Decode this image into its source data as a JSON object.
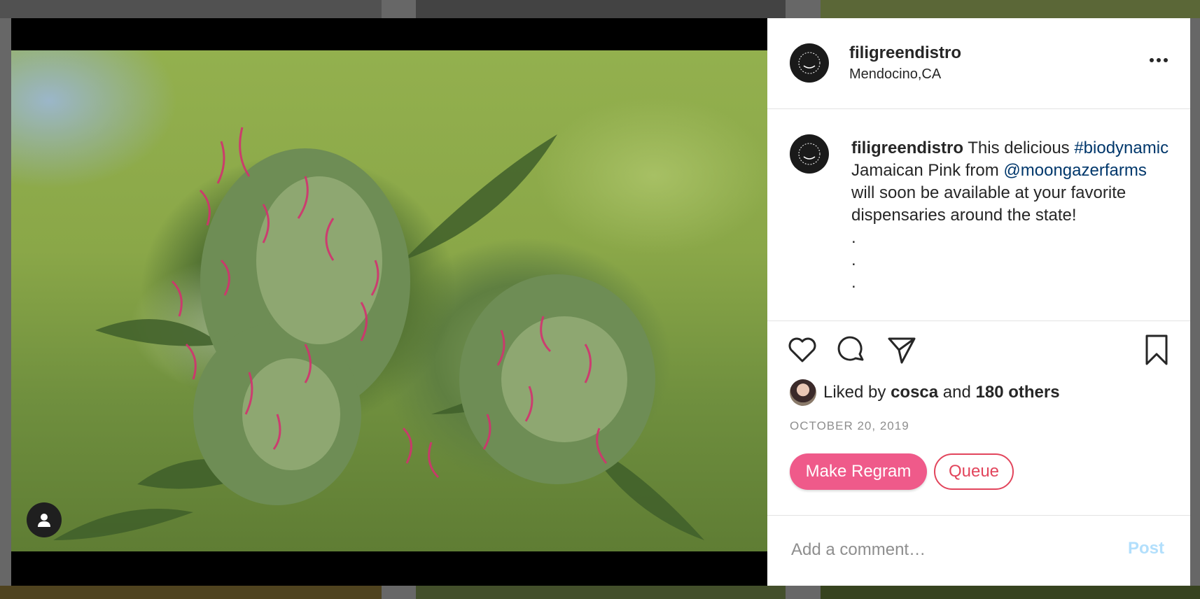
{
  "post": {
    "username": "filigreendistro",
    "location": "Mendocino,CA",
    "caption": {
      "username": "filigreendistro",
      "text_1": " This delicious ",
      "hashtag": "#biodynamic",
      "text_2": " Jamaican Pink from ",
      "mention": "@moongazerfarms",
      "text_3": " will soon be available at your favorite dispensaries around the state!",
      "dots": [
        ".",
        ".",
        "."
      ]
    },
    "likes": {
      "prefix": "Liked by ",
      "user": "cosca",
      "middle": " and ",
      "count": "180 others"
    },
    "date": "OCTOBER 20, 2019"
  },
  "buttons": {
    "regram": "Make Regram",
    "queue": "Queue"
  },
  "comment": {
    "placeholder": "Add a comment…",
    "post_label": "Post"
  },
  "colors": {
    "accent_pink": "#ef5a8a",
    "queue_red": "#e2455c",
    "link_blue": "#00376b",
    "post_disabled": "#b2dffc"
  }
}
